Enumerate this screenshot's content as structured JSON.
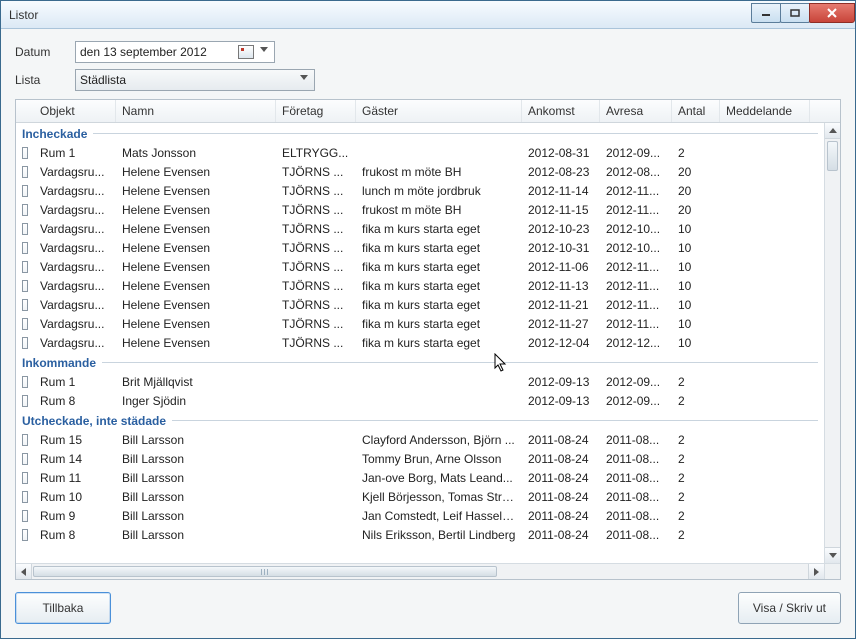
{
  "window": {
    "title": "Listor"
  },
  "filters": {
    "date_label": "Datum",
    "date_value": "den 13 september 2012",
    "list_label": "Lista",
    "list_value": "Städlista"
  },
  "columns": [
    "Objekt",
    "Namn",
    "Företag",
    "Gäster",
    "Ankomst",
    "Avresa",
    "Antal",
    "Meddelande"
  ],
  "groups": [
    {
      "title": "Incheckade",
      "rows": [
        {
          "objekt": "Rum 1",
          "namn": "Mats Jonsson",
          "foretag": "ELTRYGG...",
          "gaster": "",
          "ankomst": "2012-08-31",
          "avresa": "2012-09...",
          "antal": "2",
          "medd": ""
        },
        {
          "objekt": "Vardagsru...",
          "namn": "Helene Evensen",
          "foretag": "TJÖRNS ...",
          "gaster": "frukost m möte BH",
          "ankomst": "2012-08-23",
          "avresa": "2012-08...",
          "antal": "20",
          "medd": ""
        },
        {
          "objekt": "Vardagsru...",
          "namn": "Helene Evensen",
          "foretag": "TJÖRNS ...",
          "gaster": "lunch m möte jordbruk",
          "ankomst": "2012-11-14",
          "avresa": "2012-11...",
          "antal": "20",
          "medd": ""
        },
        {
          "objekt": "Vardagsru...",
          "namn": "Helene Evensen",
          "foretag": "TJÖRNS ...",
          "gaster": "frukost m möte BH",
          "ankomst": "2012-11-15",
          "avresa": "2012-11...",
          "antal": "20",
          "medd": ""
        },
        {
          "objekt": "Vardagsru...",
          "namn": "Helene Evensen",
          "foretag": "TJÖRNS ...",
          "gaster": "fika m kurs starta eget",
          "ankomst": "2012-10-23",
          "avresa": "2012-10...",
          "antal": "10",
          "medd": ""
        },
        {
          "objekt": "Vardagsru...",
          "namn": "Helene Evensen",
          "foretag": "TJÖRNS ...",
          "gaster": "fika m kurs starta eget",
          "ankomst": "2012-10-31",
          "avresa": "2012-10...",
          "antal": "10",
          "medd": ""
        },
        {
          "objekt": "Vardagsru...",
          "namn": "Helene Evensen",
          "foretag": "TJÖRNS ...",
          "gaster": "fika m kurs starta eget",
          "ankomst": "2012-11-06",
          "avresa": "2012-11...",
          "antal": "10",
          "medd": ""
        },
        {
          "objekt": "Vardagsru...",
          "namn": "Helene Evensen",
          "foretag": "TJÖRNS ...",
          "gaster": "fika m kurs starta eget",
          "ankomst": "2012-11-13",
          "avresa": "2012-11...",
          "antal": "10",
          "medd": ""
        },
        {
          "objekt": "Vardagsru...",
          "namn": "Helene Evensen",
          "foretag": "TJÖRNS ...",
          "gaster": "fika m kurs starta eget",
          "ankomst": "2012-11-21",
          "avresa": "2012-11...",
          "antal": "10",
          "medd": ""
        },
        {
          "objekt": "Vardagsru...",
          "namn": "Helene Evensen",
          "foretag": "TJÖRNS ...",
          "gaster": "fika m kurs starta eget",
          "ankomst": "2012-11-27",
          "avresa": "2012-11...",
          "antal": "10",
          "medd": ""
        },
        {
          "objekt": "Vardagsru...",
          "namn": "Helene Evensen",
          "foretag": "TJÖRNS ...",
          "gaster": "fika m kurs starta eget",
          "ankomst": "2012-12-04",
          "avresa": "2012-12...",
          "antal": "10",
          "medd": ""
        }
      ]
    },
    {
      "title": "Inkommande",
      "rows": [
        {
          "objekt": "Rum 1",
          "namn": "Brit Mjällqvist",
          "foretag": "",
          "gaster": "",
          "ankomst": "2012-09-13",
          "avresa": "2012-09...",
          "antal": "2",
          "medd": ""
        },
        {
          "objekt": "Rum 8",
          "namn": "Inger Sjödin",
          "foretag": "",
          "gaster": "",
          "ankomst": "2012-09-13",
          "avresa": "2012-09...",
          "antal": "2",
          "medd": ""
        }
      ]
    },
    {
      "title": "Utcheckade, inte städade",
      "rows": [
        {
          "objekt": "Rum 15",
          "namn": "Bill  Larsson",
          "foretag": "",
          "gaster": "Clayford Andersson, Björn ...",
          "ankomst": "2011-08-24",
          "avresa": "2011-08...",
          "antal": "2",
          "medd": ""
        },
        {
          "objekt": "Rum 14",
          "namn": "Bill  Larsson",
          "foretag": "",
          "gaster": "Tommy Brun, Arne Olsson",
          "ankomst": "2011-08-24",
          "avresa": "2011-08...",
          "antal": "2",
          "medd": ""
        },
        {
          "objekt": "Rum 11",
          "namn": "Bill  Larsson",
          "foretag": "",
          "gaster": "Jan-ove Borg, Mats Leand...",
          "ankomst": "2011-08-24",
          "avresa": "2011-08...",
          "antal": "2",
          "medd": ""
        },
        {
          "objekt": "Rum 10",
          "namn": "Bill  Larsson",
          "foretag": "",
          "gaster": "Kjell Börjesson, Tomas Ström",
          "ankomst": "2011-08-24",
          "avresa": "2011-08...",
          "antal": "2",
          "medd": ""
        },
        {
          "objekt": "Rum 9",
          "namn": "Bill  Larsson",
          "foretag": "",
          "gaster": "Jan Comstedt, Leif Hasselg...",
          "ankomst": "2011-08-24",
          "avresa": "2011-08...",
          "antal": "2",
          "medd": ""
        },
        {
          "objekt": "Rum 8",
          "namn": "Bill  Larsson",
          "foretag": "",
          "gaster": "Nils Eriksson, Bertil Lindberg",
          "ankomst": "2011-08-24",
          "avresa": "2011-08...",
          "antal": "2",
          "medd": ""
        }
      ]
    }
  ],
  "buttons": {
    "back": "Tillbaka",
    "print": "Visa / Skriv ut"
  }
}
